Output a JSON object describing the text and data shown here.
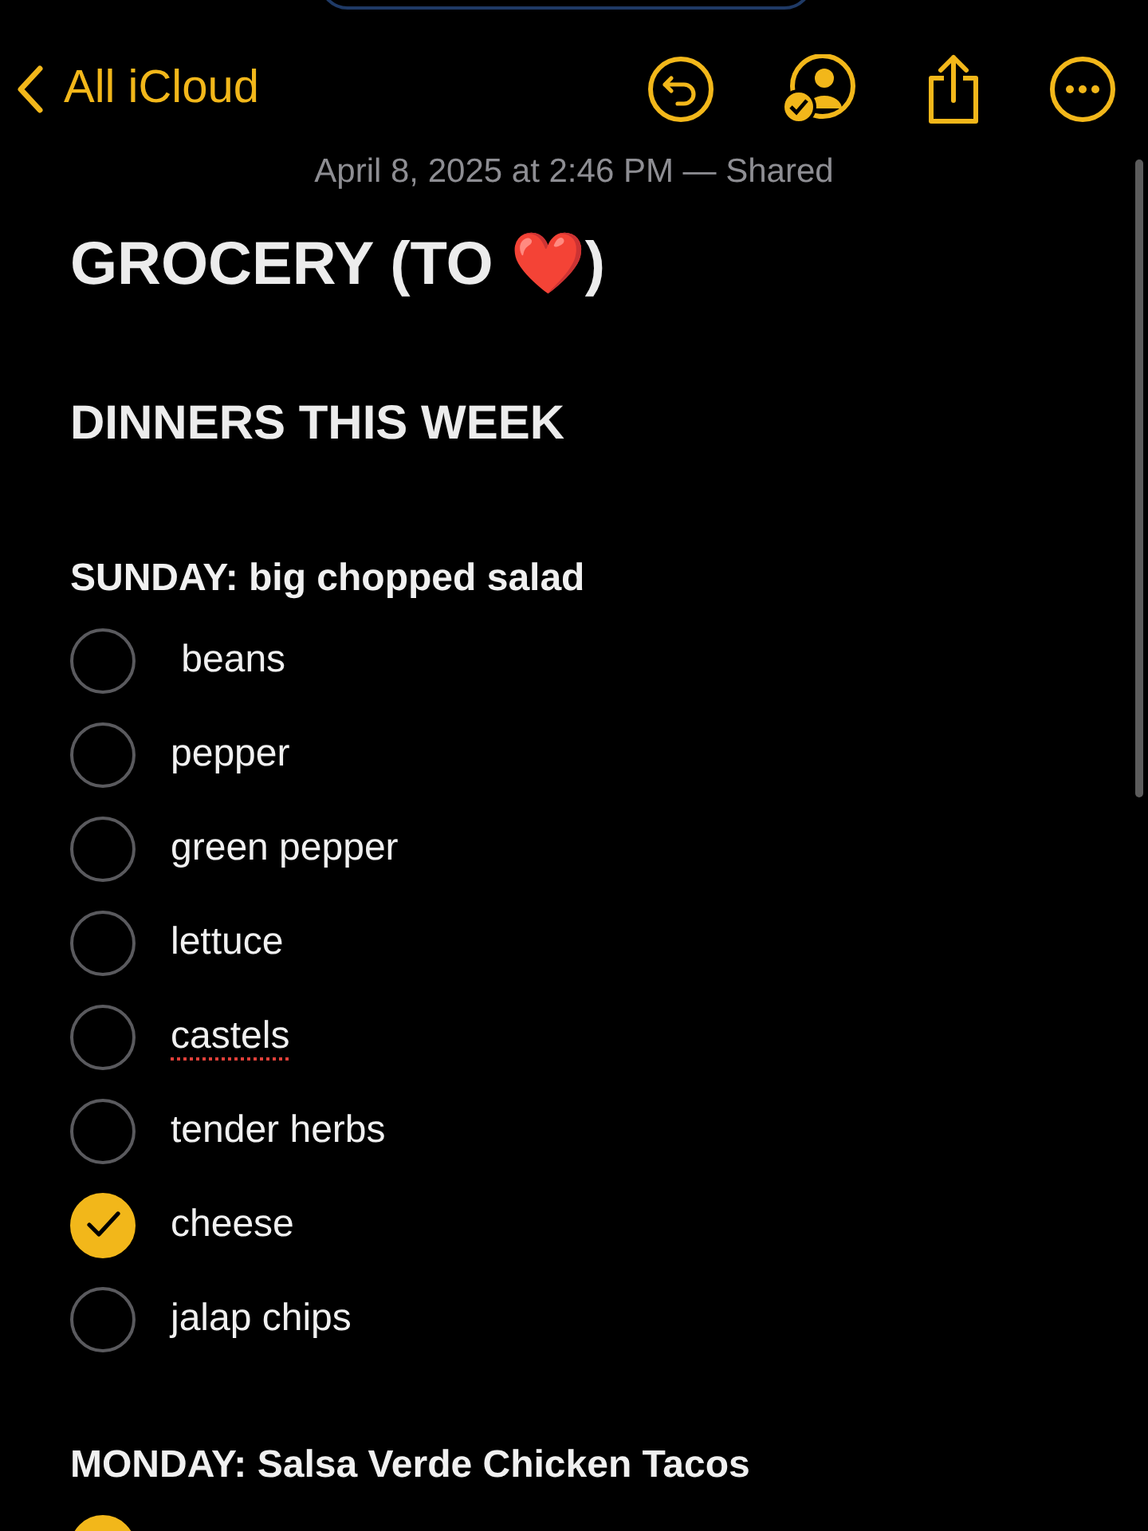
{
  "nav": {
    "back_label": "All iCloud"
  },
  "meta": "April 8, 2025 at 2:46 PM — Shared",
  "title": "GROCERY (TO ❤️)",
  "heading": "DINNERS THIS WEEK",
  "sections": [
    {
      "title": "SUNDAY: big chopped salad",
      "items": [
        {
          "label": " beans",
          "checked": false,
          "misspelled": false
        },
        {
          "label": "pepper",
          "checked": false,
          "misspelled": false
        },
        {
          "label": "green pepper",
          "checked": false,
          "misspelled": false
        },
        {
          "label": "lettuce",
          "checked": false,
          "misspelled": false
        },
        {
          "label": "castels",
          "checked": false,
          "misspelled": true
        },
        {
          "label": "tender herbs",
          "checked": false,
          "misspelled": false
        },
        {
          "label": "cheese",
          "checked": true,
          "misspelled": false
        },
        {
          "label": "jalap chips",
          "checked": false,
          "misspelled": false
        }
      ]
    },
    {
      "title": "MONDAY: Salsa Verde Chicken Tacos",
      "items": [
        {
          "checked": true
        }
      ]
    }
  ]
}
